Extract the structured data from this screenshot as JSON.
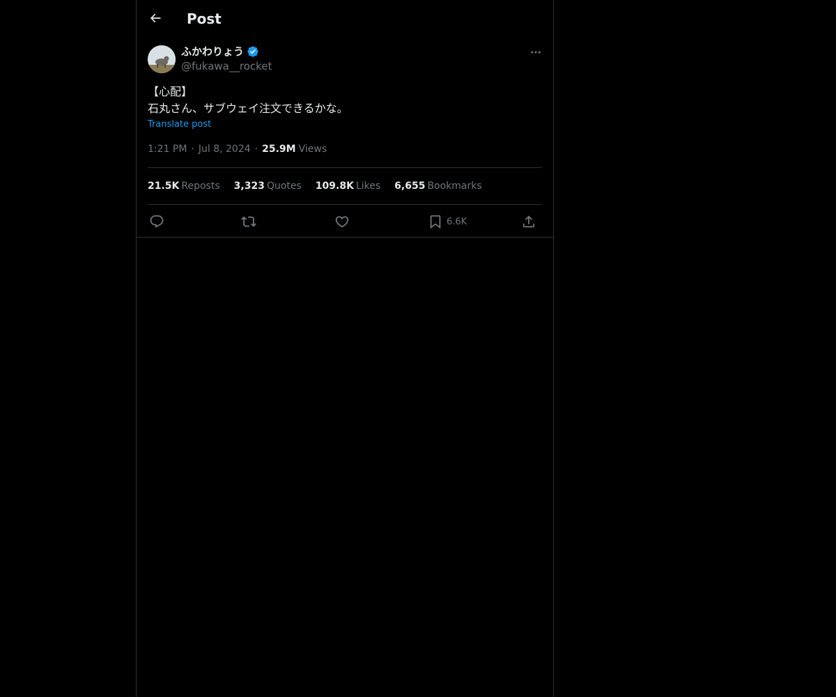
{
  "header": {
    "title": "Post",
    "back_icon": "arrow-left-icon"
  },
  "post": {
    "author": {
      "display_name": "ふかわりょう",
      "handle": "@fukawa__rocket",
      "verified": true,
      "verified_color": "#1d9bf0"
    },
    "text": "【心配】\n石丸さん、サブウェイ注文できるかな。",
    "translate_label": "Translate post",
    "time": "1:21 PM",
    "date": "Jul 8, 2024",
    "views_count": "25.9M",
    "views_label": "Views",
    "stats": [
      {
        "count": "21.5K",
        "label": "Reposts"
      },
      {
        "count": "3,323",
        "label": "Quotes"
      },
      {
        "count": "109.8K",
        "label": "Likes"
      },
      {
        "count": "6,655",
        "label": "Bookmarks"
      }
    ],
    "actions": {
      "reply_icon": "reply-icon",
      "repost_icon": "repost-icon",
      "like_icon": "heart-icon",
      "bookmark_icon": "bookmark-icon",
      "bookmark_count": "6.6K",
      "share_icon": "share-icon"
    }
  },
  "colors": {
    "background": "#000000",
    "text_primary": "#e7e9ea",
    "text_secondary": "#71767b",
    "accent": "#1d9bf0",
    "border": "#2f3336"
  }
}
